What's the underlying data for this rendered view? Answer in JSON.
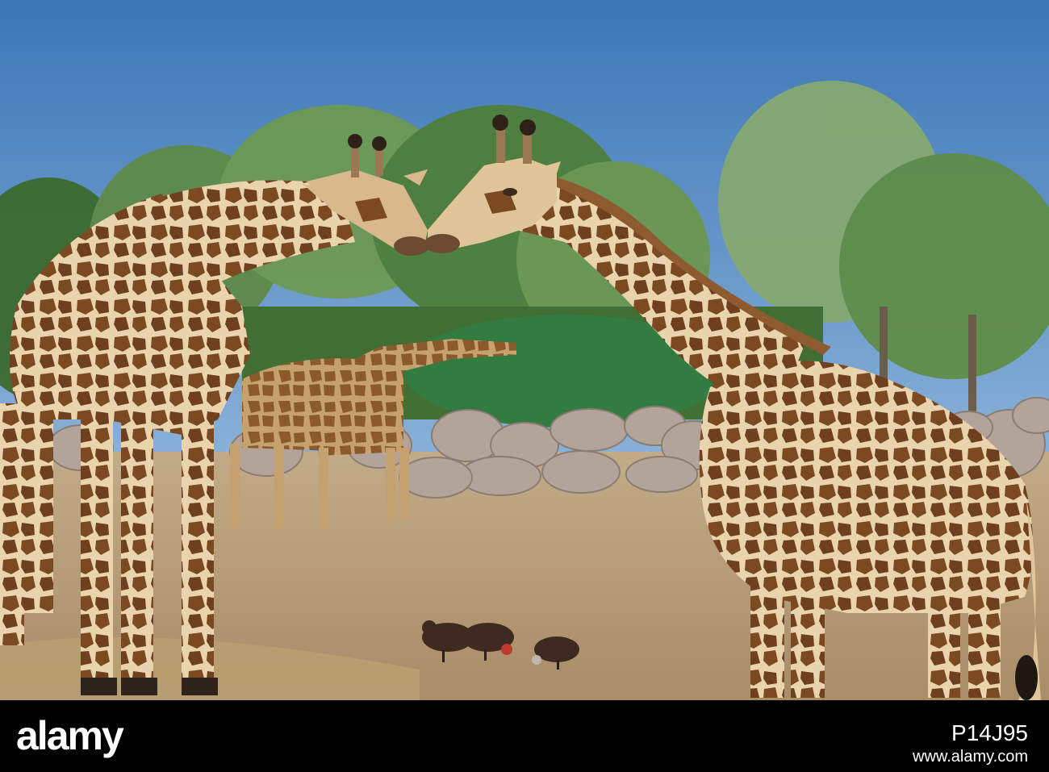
{
  "photo": {
    "subject": "two giraffes touching noses",
    "colors": {
      "sky_top": "#3f79b8",
      "sky_bottom": "#a9c9e8",
      "ground": "#b49a78",
      "giraffe_base": "#e3c9a0",
      "giraffe_patch": "#7a4a22"
    }
  },
  "watermark": {
    "logo_text": "alamy",
    "image_id": "P14J95",
    "url": "www.alamy.com"
  }
}
